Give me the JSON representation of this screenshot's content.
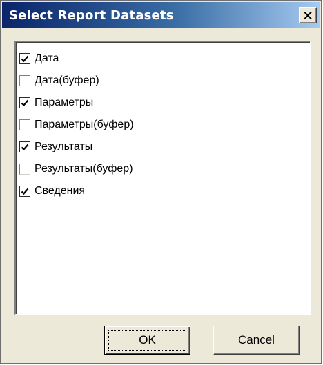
{
  "window": {
    "title": "Select Report Datasets",
    "close_icon": "close-icon"
  },
  "datasets": [
    {
      "label": "Дата",
      "checked": true
    },
    {
      "label": "Дата(буфер)",
      "checked": false
    },
    {
      "label": "Параметры",
      "checked": true
    },
    {
      "label": "Параметры(буфер)",
      "checked": false
    },
    {
      "label": "Результаты",
      "checked": true
    },
    {
      "label": "Результаты(буфер)",
      "checked": false
    },
    {
      "label": "Сведения",
      "checked": true
    }
  ],
  "buttons": {
    "ok_label": "OK",
    "cancel_label": "Cancel"
  },
  "colors": {
    "titlebar_start": "#0a246a",
    "titlebar_end": "#a6caf0",
    "dialog_face": "#ece9d8",
    "list_background": "#ffffff"
  }
}
